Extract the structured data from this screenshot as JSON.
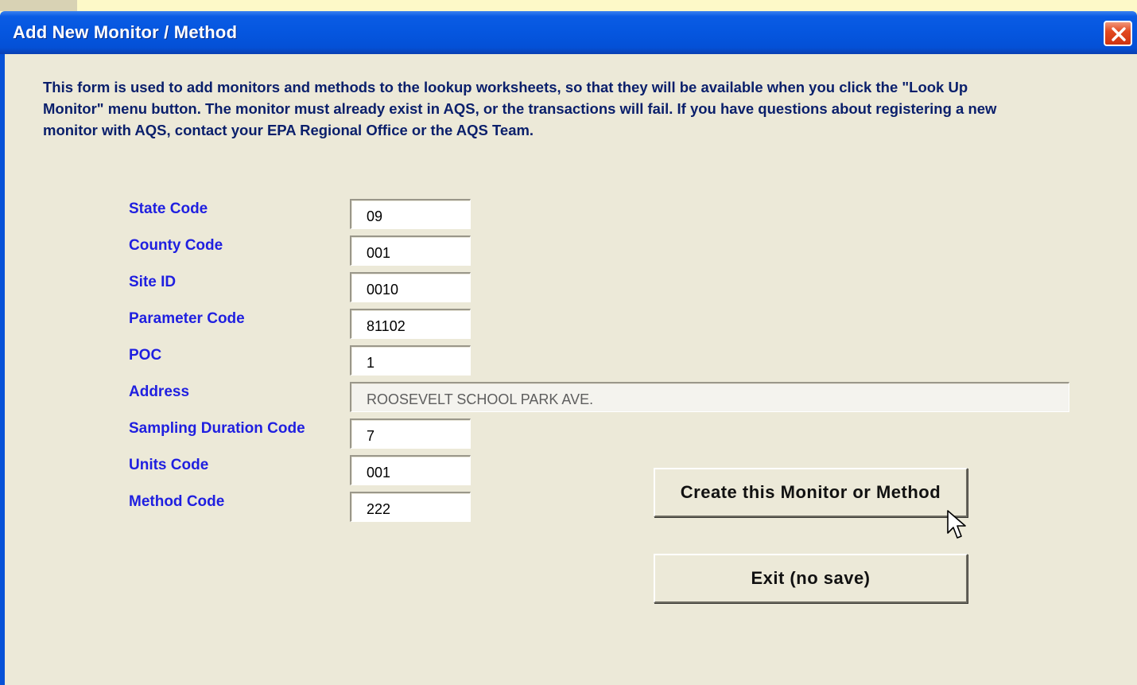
{
  "window": {
    "title": "Add New Monitor / Method",
    "close_icon": "close-icon"
  },
  "intro_text": "This form is used to add monitors and methods to the lookup worksheets, so that they will be available when you click the \"Look Up Monitor\" menu button.  The monitor must already exist in AQS, or the transactions will fail.  If you have questions about registering a new monitor with AQS, contact your EPA Regional Office or the AQS Team.",
  "fields": {
    "state_code": {
      "label": "State Code",
      "value": "09"
    },
    "county_code": {
      "label": "County Code",
      "value": "001"
    },
    "site_id": {
      "label": "Site ID",
      "value": "0010"
    },
    "parameter_code": {
      "label": "Parameter Code",
      "value": "81102"
    },
    "poc": {
      "label": "POC",
      "value": "1"
    },
    "address": {
      "label": "Address",
      "value": "ROOSEVELT SCHOOL PARK AVE."
    },
    "sampling_duration_code": {
      "label": "Sampling Duration Code",
      "value": "7"
    },
    "units_code": {
      "label": "Units Code",
      "value": "001"
    },
    "method_code": {
      "label": "Method Code",
      "value": "222"
    }
  },
  "buttons": {
    "create_label": "Create this Monitor or Method",
    "exit_label": "Exit  (no save)"
  },
  "colors": {
    "titlebar": "#0556df",
    "label": "#1f1fe0",
    "dialog_bg": "#ece9d8",
    "close": "#e24a22"
  }
}
